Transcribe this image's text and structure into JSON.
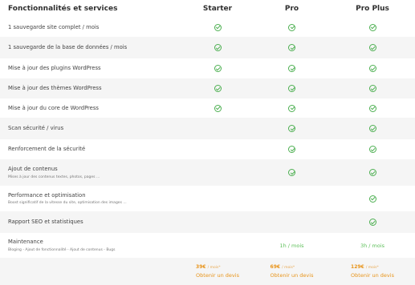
{
  "header": {
    "title": "Fonctionnalités et services",
    "plans": [
      "Starter",
      "Pro",
      "Pro Plus"
    ]
  },
  "features": [
    {
      "name": "1 sauvegarde site complet / mois",
      "starter": true,
      "pro": true,
      "proplus": true
    },
    {
      "name": "1 sauvegarde de la base de données / mois",
      "starter": true,
      "pro": true,
      "proplus": true
    },
    {
      "name": "Mise à jour des plugins WordPress",
      "starter": true,
      "pro": true,
      "proplus": true
    },
    {
      "name": "Mise à jour des thèmes WordPress",
      "starter": true,
      "pro": true,
      "proplus": true
    },
    {
      "name": "Mise à jour du core de WordPress",
      "starter": true,
      "pro": true,
      "proplus": true
    },
    {
      "name": "Scan sécurité / virus",
      "starter": false,
      "pro": true,
      "proplus": true
    },
    {
      "name": "Renforcement de la sécurité",
      "starter": false,
      "pro": true,
      "proplus": true
    },
    {
      "name": "Ajout de contenus",
      "subtitle": "Mises à jour des contenus textes, photos, pages ...",
      "starter": false,
      "pro": true,
      "proplus": true
    },
    {
      "name": "Performance et optimisation",
      "subtitle": "Boost significatif de la vitesse du site, optimisation des images ...",
      "starter": false,
      "pro": false,
      "proplus": true
    },
    {
      "name": "Rapport SEO et statistiques",
      "starter": false,
      "pro": false,
      "proplus": true
    },
    {
      "name": "Maintenance",
      "subtitle": "Bloging - Ajout de fonctionnalité - Ajout de contenus - Bugs",
      "starter": false,
      "pro": false,
      "proplus": false
    }
  ],
  "maintenance_hours": {
    "pro": "1h / mois",
    "proplus": "3h / mois"
  },
  "pricing": {
    "starter": {
      "price": "39€",
      "period": "/ mois*",
      "cta": "Obtenir un devis"
    },
    "pro": {
      "price": "69€",
      "period": "/ mois*",
      "cta": "Obtenir un devis"
    },
    "proplus": {
      "price": "129€",
      "period": "/ mois*",
      "cta": "Obtenir un devis"
    }
  },
  "colors": {
    "check": "#4caf50",
    "hours": "#5cbf58",
    "price": "#e8941a",
    "alt_row": "#f5f5f5"
  },
  "icons": {
    "included": "check-circle-icon"
  }
}
